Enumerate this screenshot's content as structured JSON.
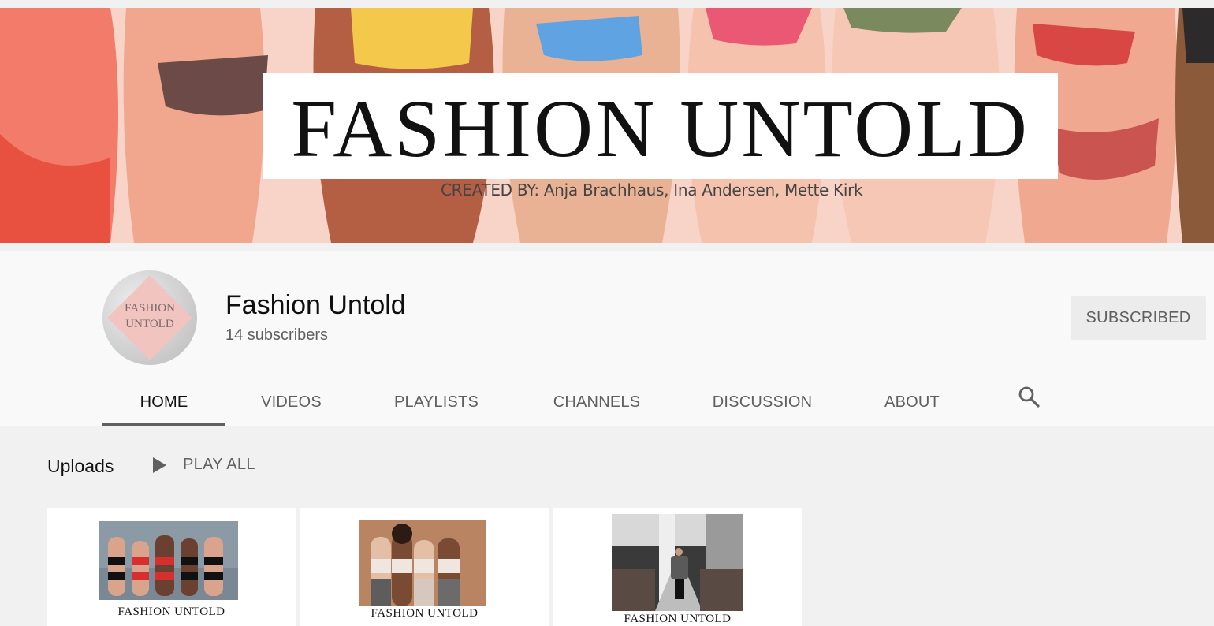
{
  "banner": {
    "title": "FASHION UNTOLD",
    "credits": "CREATED BY: Anja Brachhaus, Ina Andersen, Mette  Kirk"
  },
  "channel": {
    "avatar_text_line1": "FASHION",
    "avatar_text_line2": "UNTOLD",
    "name": "Fashion Untold",
    "subscribers": "14 subscribers",
    "subscribe_label": "SUBSCRIBED"
  },
  "tabs": [
    {
      "label": "HOME",
      "active": true
    },
    {
      "label": "VIDEOS"
    },
    {
      "label": "PLAYLISTS"
    },
    {
      "label": "CHANNELS"
    },
    {
      "label": "DISCUSSION"
    },
    {
      "label": "ABOUT"
    }
  ],
  "search_icon": "search-icon",
  "uploads": {
    "title": "Uploads",
    "play_all_label": "PLAY ALL",
    "videos": [
      {
        "caption": "FASHION UNTOLD"
      },
      {
        "caption": "FASHION UNTOLD"
      },
      {
        "caption": "FASHION UNTOLD"
      }
    ]
  },
  "colors": {
    "banner_bg": "#f7cfc3",
    "header_bg": "#f9f9f9",
    "page_bg": "#f1f1f1",
    "subscribed_bg": "#ececec"
  }
}
